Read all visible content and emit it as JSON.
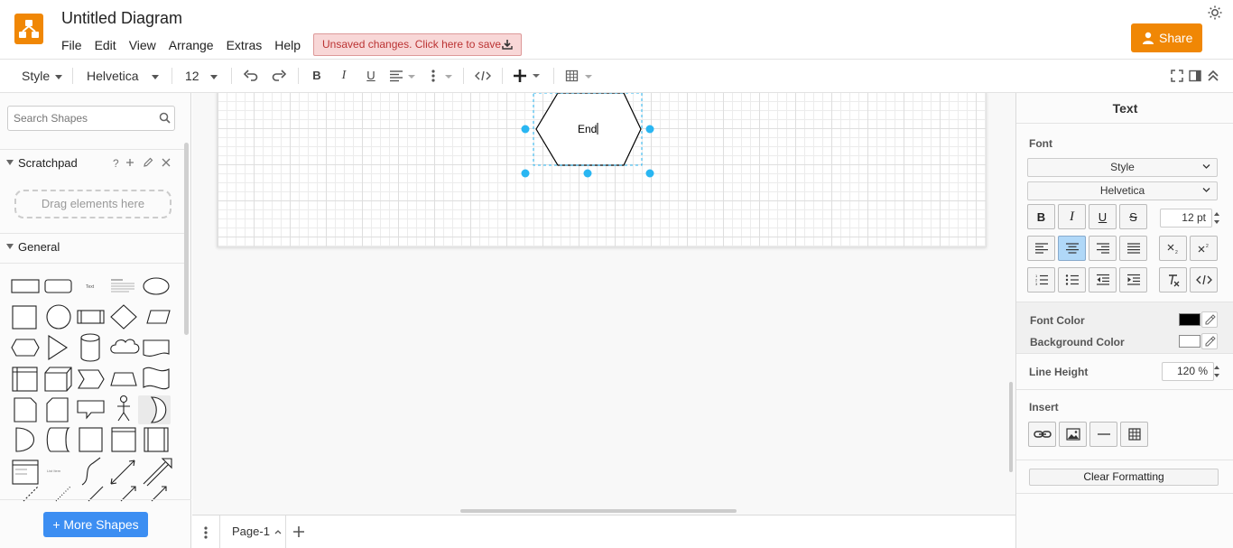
{
  "app": {
    "title": "Untitled Diagram",
    "menu": [
      "File",
      "Edit",
      "View",
      "Arrange",
      "Extras",
      "Help"
    ],
    "unsaved_label": "Unsaved changes. Click here to save.",
    "share_label": "Share"
  },
  "toolbar": {
    "style_label": "Style",
    "font_label": "Helvetica",
    "size_label": "12"
  },
  "sidebar": {
    "search_placeholder": "Search Shapes",
    "scratchpad_label": "Scratchpad",
    "scratchpad_help": "?",
    "drag_label": "Drag elements here",
    "general_label": "General",
    "more_shapes_label": "+ More Shapes"
  },
  "canvas": {
    "shape_text": "End"
  },
  "pages": {
    "current_page": "Page-1"
  },
  "format_panel": {
    "title": "Text",
    "font_section": "Font",
    "style_select": "Style",
    "font_select": "Helvetica",
    "font_size": "12 pt",
    "font_color_label": "Font Color",
    "background_color_label": "Background Color",
    "font_color": "#000000",
    "background_color": "#ffffff",
    "line_height_label": "Line Height",
    "line_height_value": "120 %",
    "insert_section": "Insert",
    "clear_formatting_label": "Clear Formatting"
  },
  "colors": {
    "accent_orange": "#f08705",
    "more_shapes_blue": "#3c8ef2",
    "selection_handle": "#29b6f2",
    "unsaved_bg": "#f8d7d7"
  }
}
